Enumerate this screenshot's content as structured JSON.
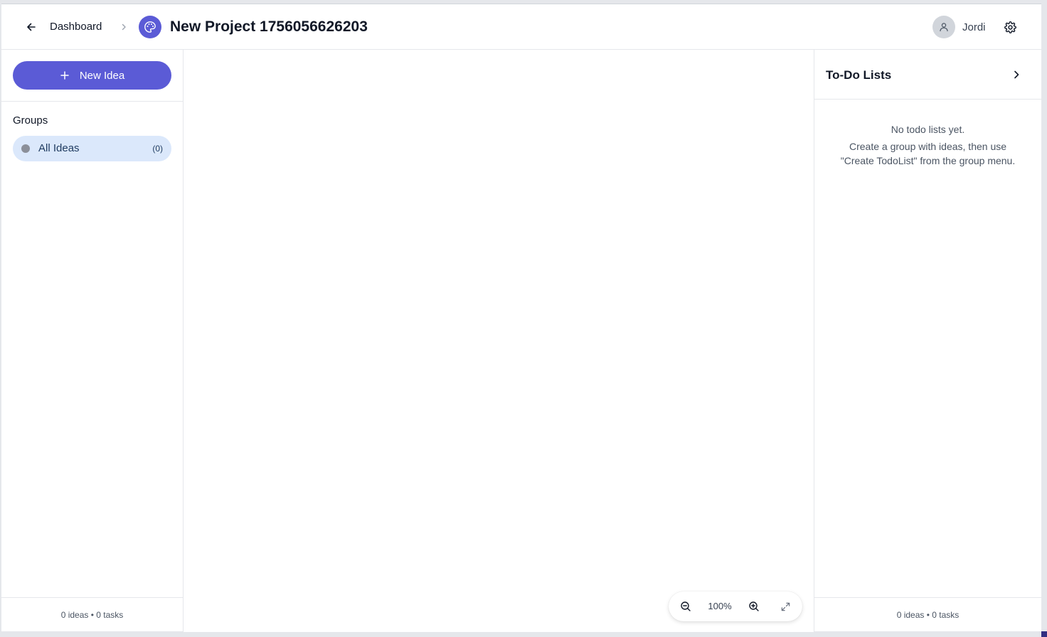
{
  "header": {
    "breadcrumb_dashboard": "Dashboard",
    "project_title": "New Project 1756056626203",
    "user_name": "Jordi",
    "back_icon": "arrow-left-icon",
    "separator_icon": "chevron-right-icon",
    "project_icon": "palette-icon",
    "settings_icon": "gear-icon"
  },
  "sidebar": {
    "new_idea_label": "New Idea",
    "groups_heading": "Groups",
    "groups": [
      {
        "label": "All Ideas",
        "count": "(0)",
        "selected": true
      }
    ],
    "footer": "0 ideas • 0 tasks"
  },
  "canvas": {
    "zoom_level": "100%"
  },
  "todo_panel": {
    "title": "To-Do Lists",
    "empty_line1": "No todo lists yet.",
    "empty_line2": "Create a group with ideas, then use",
    "empty_line3": "\"Create TodoList\" from the group menu.",
    "footer": "0 ideas • 0 tasks"
  },
  "colors": {
    "accent": "#5b5bd6",
    "selected_group_bg": "#dbe8fb"
  }
}
